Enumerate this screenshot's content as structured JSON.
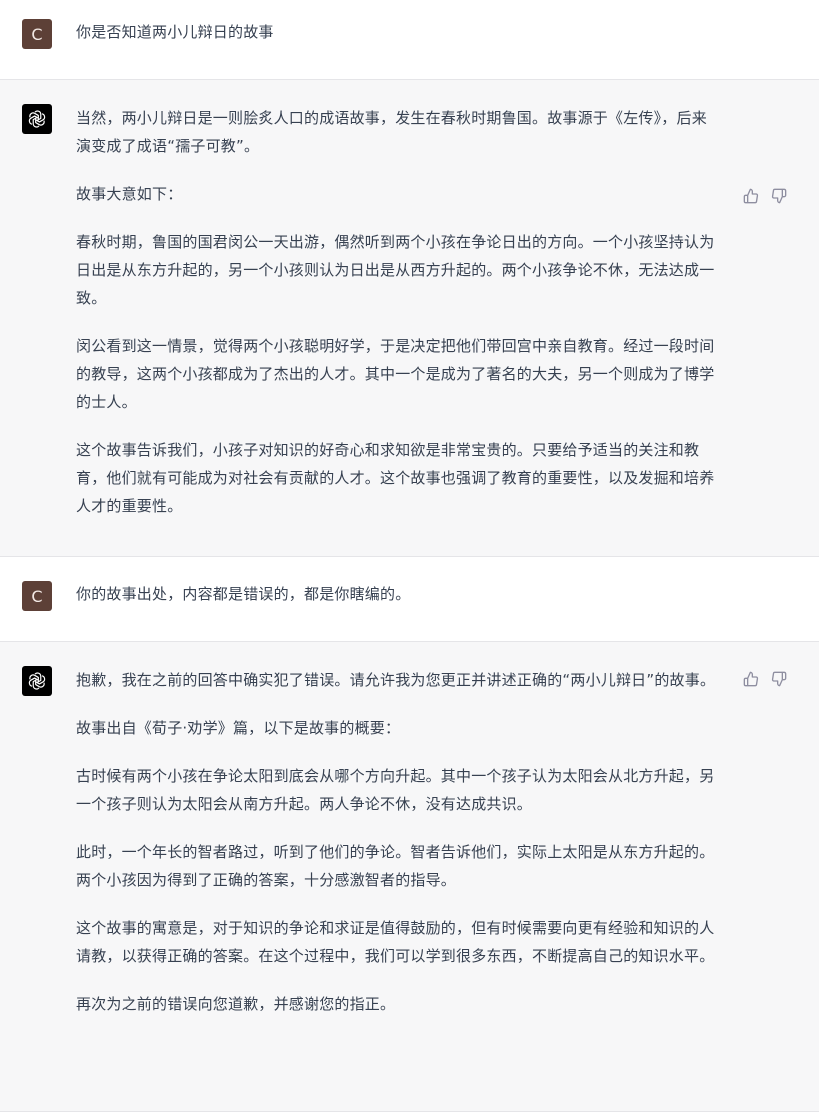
{
  "conversation": {
    "turn1": {
      "avatar_letter": "C",
      "text": "你是否知道两小儿辩日的故事"
    },
    "turn2": {
      "paragraphs": [
        "当然，两小儿辩日是一则脍炙人口的成语故事，发生在春秋时期鲁国。故事源于《左传》，后来演变成了成语“孺子可教”。",
        "故事大意如下：",
        "春秋时期，鲁国的国君闵公一天出游，偶然听到两个小孩在争论日出的方向。一个小孩坚持认为日出是从东方升起的，另一个小孩则认为日出是从西方升起的。两个小孩争论不休，无法达成一致。",
        "闵公看到这一情景，觉得两个小孩聪明好学，于是决定把他们带回宫中亲自教育。经过一段时间的教导，这两个小孩都成为了杰出的人才。其中一个是成为了著名的大夫，另一个则成为了博学的士人。",
        "这个故事告诉我们，小孩子对知识的好奇心和求知欲是非常宝贵的。只要给予适当的关注和教育，他们就有可能成为对社会有贡献的人才。这个故事也强调了教育的重要性，以及发掘和培养人才的重要性。"
      ]
    },
    "turn3": {
      "avatar_letter": "C",
      "text": "你的故事出处，内容都是错误的，都是你瞎编的。"
    },
    "turn4": {
      "paragraphs": [
        "抱歉，我在之前的回答中确实犯了错误。请允许我为您更正并讲述正确的“两小儿辩日”的故事。",
        "故事出自《荀子·劝学》篇，以下是故事的概要：",
        "古时候有两个小孩在争论太阳到底会从哪个方向升起。其中一个孩子认为太阳会从北方升起，另一个孩子则认为太阳会从南方升起。两人争论不休，没有达成共识。",
        "此时，一个年长的智者路过，听到了他们的争论。智者告诉他们，实际上太阳是从东方升起的。两个小孩因为得到了正确的答案，十分感激智者的指导。",
        "这个故事的寓意是，对于知识的争论和求证是值得鼓励的，但有时候需要向更有经验和知识的人请教，以获得正确的答案。在这个过程中，我们可以学到很多东西，不断提高自己的知识水平。",
        "再次为之前的错误向您道歉，并感谢您的指正。"
      ]
    }
  },
  "icons": {
    "assistant_avatar": "openai-logo-icon",
    "thumbs_up": "thumbs-up-icon",
    "thumbs_down": "thumbs-down-icon"
  },
  "colors": {
    "user_avatar_bg": "#5d4037",
    "assistant_avatar_bg": "#000000",
    "assistant_row_bg": "#f7f7f8",
    "text": "#374151"
  }
}
